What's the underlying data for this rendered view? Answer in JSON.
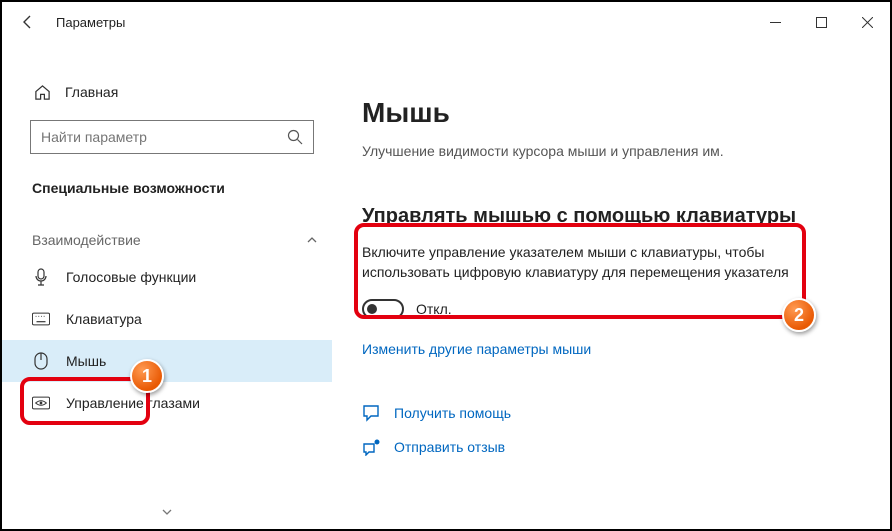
{
  "titlebar": {
    "title": "Параметры"
  },
  "sidebar": {
    "home": "Главная",
    "search_placeholder": "Найти параметр",
    "section": "Специальные возможности",
    "group": "Взаимодействие",
    "items": [
      {
        "label": "Голосовые функции"
      },
      {
        "label": "Клавиатура"
      },
      {
        "label": "Мышь"
      },
      {
        "label": "Управление глазами"
      }
    ]
  },
  "content": {
    "title": "Мышь",
    "subtitle": "Улучшение видимости курсора мыши и управления им.",
    "section_heading": "Управлять мышью с помощью клавиатуры",
    "setting_desc": "Включите управление указателем мыши с клавиатуры, чтобы использовать цифровую клавиатуру для перемещения указателя",
    "toggle_state": "Откл.",
    "link_other": "Изменить другие параметры мыши",
    "help": "Получить помощь",
    "feedback": "Отправить отзыв"
  },
  "callouts": {
    "badge1": "1",
    "badge2": "2"
  }
}
